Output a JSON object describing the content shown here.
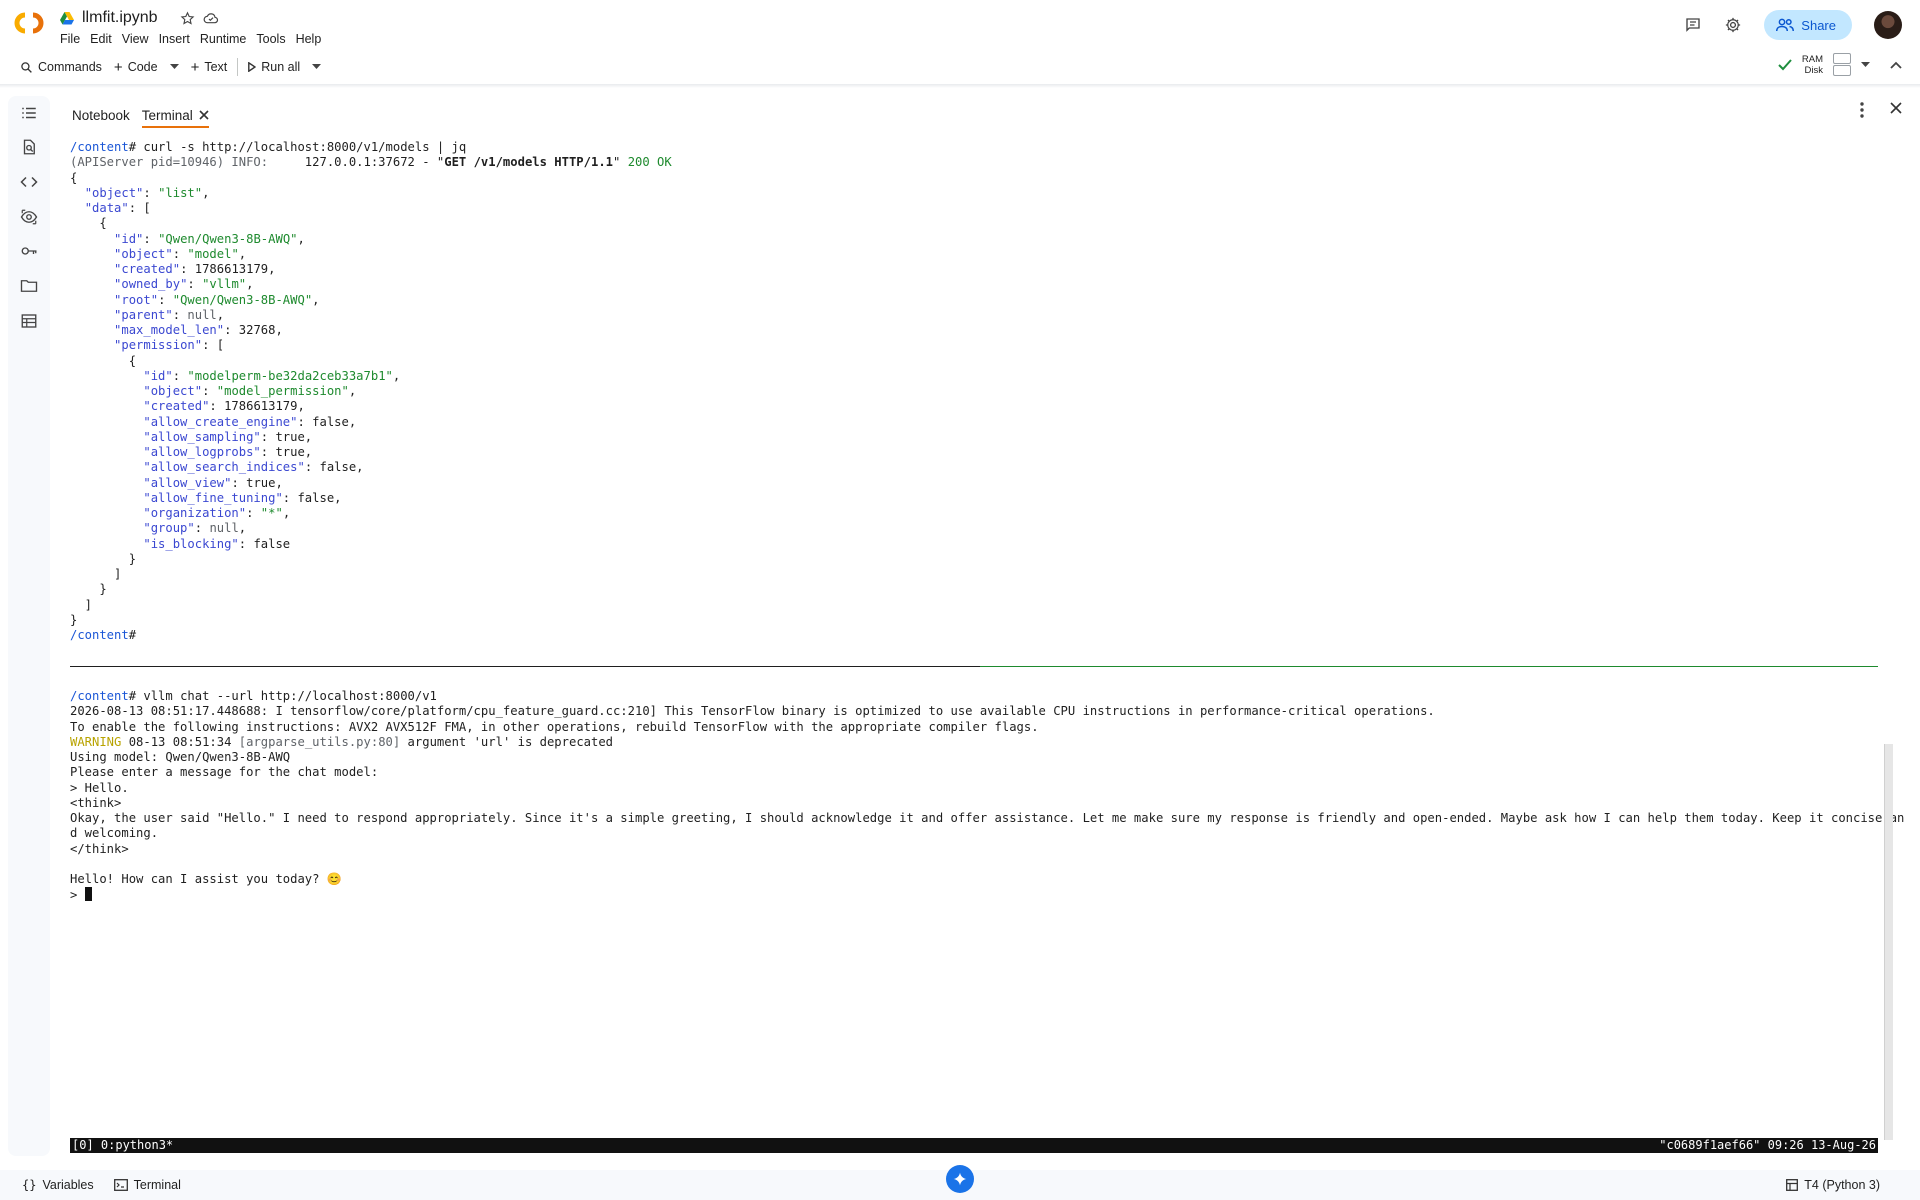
{
  "header": {
    "file_name": "llmfit.ipynb",
    "menu": [
      "File",
      "Edit",
      "View",
      "Insert",
      "Runtime",
      "Tools",
      "Help"
    ],
    "share_label": "Share"
  },
  "toolbar": {
    "commands_label": "Commands",
    "code_label": "Code",
    "text_label": "Text",
    "run_all_label": "Run all",
    "ram_label": "RAM",
    "disk_label": "Disk"
  },
  "tabs": [
    {
      "label": "Notebook",
      "active": false
    },
    {
      "label": "Terminal",
      "active": true
    }
  ],
  "terminal": {
    "lines": [
      [
        {
          "t": "/content",
          "c": "prompt"
        },
        {
          "t": "# curl -s http://localhost:8000/v1/models | jq"
        }
      ],
      [
        {
          "t": "(APIServer pid=10946) INFO:",
          "c": "dim"
        },
        {
          "t": "     127.0.0.1:37672 - \""
        },
        {
          "t": "GET /v1/models HTTP/1.1",
          "c": "bold"
        },
        {
          "t": "\" "
        },
        {
          "t": "200 OK",
          "c": "str"
        }
      ],
      [
        {
          "t": "{"
        }
      ],
      [
        {
          "t": "  "
        },
        {
          "t": "\"object\"",
          "c": "key"
        },
        {
          "t": ": "
        },
        {
          "t": "\"list\"",
          "c": "str"
        },
        {
          "t": ","
        }
      ],
      [
        {
          "t": "  "
        },
        {
          "t": "\"data\"",
          "c": "key"
        },
        {
          "t": ": ["
        }
      ],
      [
        {
          "t": "    {"
        }
      ],
      [
        {
          "t": "      "
        },
        {
          "t": "\"id\"",
          "c": "key"
        },
        {
          "t": ": "
        },
        {
          "t": "\"Qwen/Qwen3-8B-AWQ\"",
          "c": "str"
        },
        {
          "t": ","
        }
      ],
      [
        {
          "t": "      "
        },
        {
          "t": "\"object\"",
          "c": "key"
        },
        {
          "t": ": "
        },
        {
          "t": "\"model\"",
          "c": "str"
        },
        {
          "t": ","
        }
      ],
      [
        {
          "t": "      "
        },
        {
          "t": "\"created\"",
          "c": "key"
        },
        {
          "t": ": 1786613179,"
        }
      ],
      [
        {
          "t": "      "
        },
        {
          "t": "\"owned_by\"",
          "c": "key"
        },
        {
          "t": ": "
        },
        {
          "t": "\"vllm\"",
          "c": "str"
        },
        {
          "t": ","
        }
      ],
      [
        {
          "t": "      "
        },
        {
          "t": "\"root\"",
          "c": "key"
        },
        {
          "t": ": "
        },
        {
          "t": "\"Qwen/Qwen3-8B-AWQ\"",
          "c": "str"
        },
        {
          "t": ","
        }
      ],
      [
        {
          "t": "      "
        },
        {
          "t": "\"parent\"",
          "c": "key"
        },
        {
          "t": ": "
        },
        {
          "t": "null",
          "c": "dim"
        },
        {
          "t": ","
        }
      ],
      [
        {
          "t": "      "
        },
        {
          "t": "\"max_model_len\"",
          "c": "key"
        },
        {
          "t": ": 32768,"
        }
      ],
      [
        {
          "t": "      "
        },
        {
          "t": "\"permission\"",
          "c": "key"
        },
        {
          "t": ": ["
        }
      ],
      [
        {
          "t": "        {"
        }
      ],
      [
        {
          "t": "          "
        },
        {
          "t": "\"id\"",
          "c": "key"
        },
        {
          "t": ": "
        },
        {
          "t": "\"modelperm-be32da2ceb33a7b1\"",
          "c": "str"
        },
        {
          "t": ","
        }
      ],
      [
        {
          "t": "          "
        },
        {
          "t": "\"object\"",
          "c": "key"
        },
        {
          "t": ": "
        },
        {
          "t": "\"model_permission\"",
          "c": "str"
        },
        {
          "t": ","
        }
      ],
      [
        {
          "t": "          "
        },
        {
          "t": "\"created\"",
          "c": "key"
        },
        {
          "t": ": 1786613179,"
        }
      ],
      [
        {
          "t": "          "
        },
        {
          "t": "\"allow_create_engine\"",
          "c": "key"
        },
        {
          "t": ": false,"
        }
      ],
      [
        {
          "t": "          "
        },
        {
          "t": "\"allow_sampling\"",
          "c": "key"
        },
        {
          "t": ": true,"
        }
      ],
      [
        {
          "t": "          "
        },
        {
          "t": "\"allow_logprobs\"",
          "c": "key"
        },
        {
          "t": ": true,"
        }
      ],
      [
        {
          "t": "          "
        },
        {
          "t": "\"allow_search_indices\"",
          "c": "key"
        },
        {
          "t": ": false,"
        }
      ],
      [
        {
          "t": "          "
        },
        {
          "t": "\"allow_view\"",
          "c": "key"
        },
        {
          "t": ": true,"
        }
      ],
      [
        {
          "t": "          "
        },
        {
          "t": "\"allow_fine_tuning\"",
          "c": "key"
        },
        {
          "t": ": false,"
        }
      ],
      [
        {
          "t": "          "
        },
        {
          "t": "\"organization\"",
          "c": "key"
        },
        {
          "t": ": "
        },
        {
          "t": "\"*\"",
          "c": "str"
        },
        {
          "t": ","
        }
      ],
      [
        {
          "t": "          "
        },
        {
          "t": "\"group\"",
          "c": "key"
        },
        {
          "t": ": "
        },
        {
          "t": "null",
          "c": "dim"
        },
        {
          "t": ","
        }
      ],
      [
        {
          "t": "          "
        },
        {
          "t": "\"is_blocking\"",
          "c": "key"
        },
        {
          "t": ": false"
        }
      ],
      [
        {
          "t": "        }"
        }
      ],
      [
        {
          "t": "      ]"
        }
      ],
      [
        {
          "t": "    }"
        }
      ],
      [
        {
          "t": "  ]"
        }
      ],
      [
        {
          "t": "}"
        }
      ],
      [
        {
          "t": "/content",
          "c": "prompt"
        },
        {
          "t": "#"
        }
      ],
      [],
      [],
      [],
      [
        {
          "t": "/content",
          "c": "prompt"
        },
        {
          "t": "# vllm chat --url http://localhost:8000/v1"
        }
      ],
      [
        {
          "t": "2026-08-13 08:51:17.448688: I tensorflow/core/platform/cpu_feature_guard.cc:210] This TensorFlow binary is optimized to use available CPU instructions in performance-critical operations."
        }
      ],
      [
        {
          "t": "To enable the following instructions: AVX2 AVX512F FMA, in other operations, rebuild TensorFlow with the appropriate compiler flags."
        }
      ],
      [
        {
          "t": "WARNING",
          "c": "warn"
        },
        {
          "t": " 08-13 08:51:34 "
        },
        {
          "t": "[argparse_utils.py:80]",
          "c": "dim"
        },
        {
          "t": " argument 'url' is deprecated"
        }
      ],
      [
        {
          "t": "Using model: Qwen/Qwen3-8B-AWQ"
        }
      ],
      [
        {
          "t": "Please enter a message for the chat model:"
        }
      ],
      [
        {
          "t": "> Hello."
        }
      ],
      [
        {
          "t": "<think>"
        }
      ],
      [
        {
          "t": "Okay, the user said \"Hello.\" I need to respond appropriately. Since it's a simple greeting, I should acknowledge it and offer assistance. Let me make sure my response is friendly and open-ended. Maybe ask how I can help them today. Keep it concise an"
        }
      ],
      [
        {
          "t": "d welcoming."
        }
      ],
      [
        {
          "t": "</think>"
        }
      ],
      [],
      [
        {
          "t": "Hello! How can I assist you today? 😊"
        }
      ],
      [
        {
          "t": "> "
        },
        {
          "cursor": true
        }
      ]
    ]
  },
  "statusbar": {
    "left": "[0] 0:python3*",
    "right": "\"c0689f1aef66\" 09:26 13-Aug-26"
  },
  "bottombar": {
    "variables_label": "Variables",
    "terminal_label": "Terminal",
    "runtime_label": "T4 (Python 3)"
  },
  "colors": {
    "accent": "#e8710a",
    "share_bg": "#c2e7ff",
    "prompt": "#1a56d6",
    "string": "#1e8a2e",
    "key": "#3b48d1"
  }
}
